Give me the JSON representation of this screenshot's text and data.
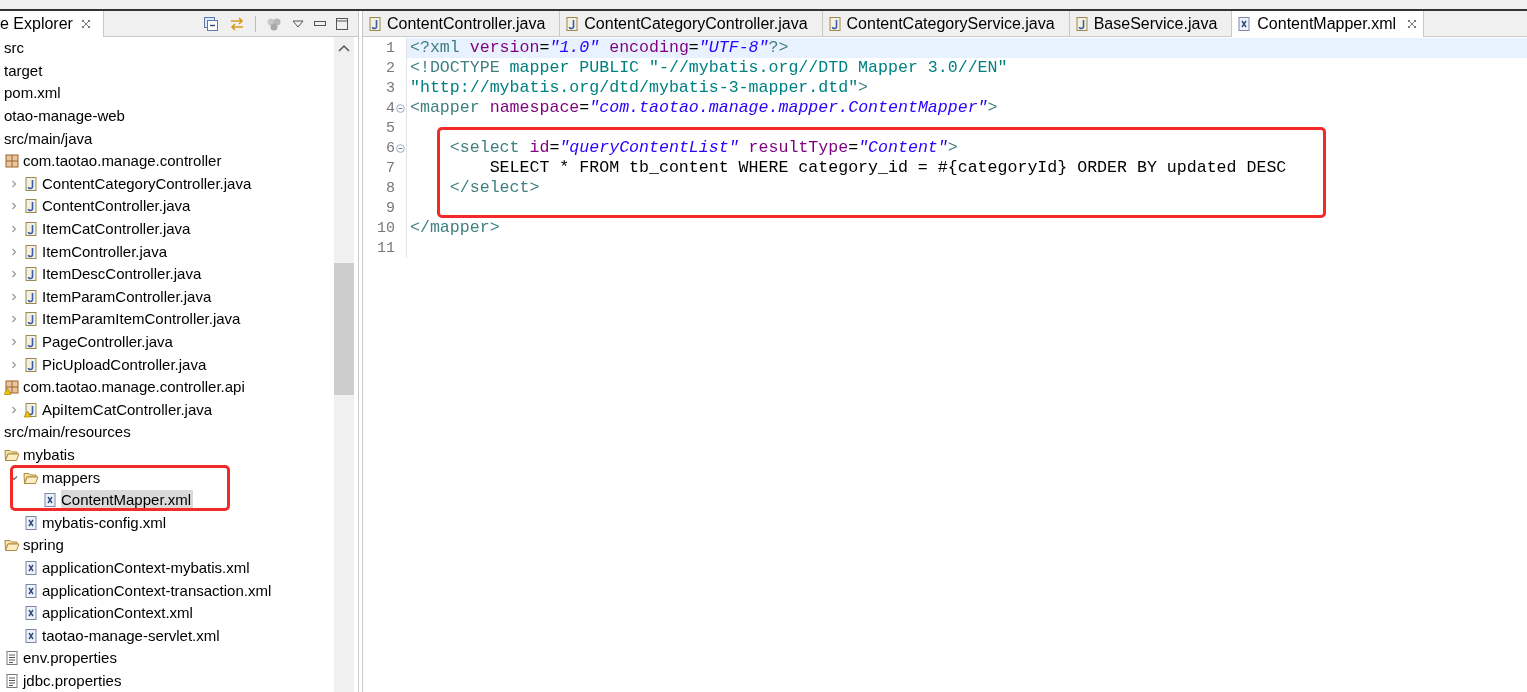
{
  "explorer": {
    "title": "e Explorer",
    "tree": [
      {
        "label": "src",
        "selected": false
      },
      {
        "label": "target",
        "selected": false
      },
      {
        "label": "pom.xml",
        "selected": false
      },
      {
        "label": "otao-manage-web",
        "selected": false
      },
      {
        "label": "src/main/java",
        "selected": false,
        "children": [
          {
            "label": "com.taotao.manage.controller",
            "kind": "package",
            "selected": false,
            "children": [
              {
                "label": "ContentCategoryController.java",
                "kind": "java",
                "expanded": false,
                "selected": false
              },
              {
                "label": "ContentController.java",
                "kind": "java",
                "expanded": false,
                "selected": false
              },
              {
                "label": "ItemCatController.java",
                "kind": "java",
                "expanded": false,
                "selected": false
              },
              {
                "label": "ItemController.java",
                "kind": "java",
                "expanded": false,
                "selected": false
              },
              {
                "label": "ItemDescController.java",
                "kind": "java",
                "expanded": false,
                "selected": false
              },
              {
                "label": "ItemParamController.java",
                "kind": "java",
                "expanded": false,
                "selected": false
              },
              {
                "label": "ItemParamItemController.java",
                "kind": "java",
                "expanded": false,
                "selected": false
              },
              {
                "label": "PageController.java",
                "kind": "java",
                "expanded": false,
                "selected": false
              },
              {
                "label": "PicUploadController.java",
                "kind": "java",
                "expanded": false,
                "selected": false
              }
            ]
          },
          {
            "label": "com.taotao.manage.controller.api",
            "kind": "package-warning",
            "selected": false,
            "children": [
              {
                "label": "ApiItemCatController.java",
                "kind": "java-warning",
                "expanded": false,
                "selected": false
              }
            ]
          }
        ]
      },
      {
        "label": "src/main/resources",
        "selected": false,
        "children": [
          {
            "label": "mybatis",
            "kind": "folder",
            "selected": false,
            "children": [
              {
                "label": "mappers",
                "kind": "folder",
                "expanded": true,
                "selected": false,
                "children": [
                  {
                    "label": "ContentMapper.xml",
                    "kind": "xml",
                    "selected": true
                  }
                ]
              },
              {
                "label": "mybatis-config.xml",
                "kind": "xml",
                "selected": false
              }
            ]
          },
          {
            "label": "spring",
            "kind": "folder",
            "selected": false,
            "children": [
              {
                "label": "applicationContext-mybatis.xml",
                "kind": "xml",
                "selected": false
              },
              {
                "label": "applicationContext-transaction.xml",
                "kind": "xml",
                "selected": false
              },
              {
                "label": "applicationContext.xml",
                "kind": "xml",
                "selected": false
              },
              {
                "label": "taotao-manage-servlet.xml",
                "kind": "xml",
                "selected": false
              }
            ]
          },
          {
            "label": "env.properties",
            "kind": "properties",
            "selected": false
          },
          {
            "label": "jdbc.properties",
            "kind": "properties",
            "selected": false
          }
        ]
      }
    ]
  },
  "editor": {
    "tabs": [
      {
        "label": "ContentController.java",
        "kind": "java",
        "selected": false
      },
      {
        "label": "ContentCategoryController.java",
        "kind": "java",
        "selected": false
      },
      {
        "label": "ContentCategoryService.java",
        "kind": "java",
        "selected": false
      },
      {
        "label": "BaseService.java",
        "kind": "java",
        "selected": false
      },
      {
        "label": "ContentMapper.xml",
        "kind": "xml",
        "selected": true
      }
    ],
    "lines": [
      {
        "number": "1",
        "current": true,
        "fold": false,
        "tokens": [
          {
            "kind": "tag",
            "text": "<?xml "
          },
          {
            "kind": "attr",
            "text": "version"
          },
          {
            "kind": "text",
            "text": "="
          },
          {
            "kind": "value",
            "text": "\"1.0\" "
          },
          {
            "kind": "attr",
            "text": "encoding"
          },
          {
            "kind": "text",
            "text": "="
          },
          {
            "kind": "value",
            "text": "\"UTF-8\""
          },
          {
            "kind": "tag",
            "text": "?>"
          }
        ]
      },
      {
        "number": "2",
        "current": false,
        "fold": false,
        "tokens": [
          {
            "kind": "tag",
            "text": "<!DOCTYPE "
          },
          {
            "kind": "doctype",
            "text": "mapper PUBLIC \"-//mybatis.org//DTD Mapper 3.0//EN\""
          }
        ]
      },
      {
        "number": "3",
        "current": false,
        "fold": false,
        "tokens": [
          {
            "kind": "doctype",
            "text": "\"http://mybatis.org/dtd/mybatis-3-mapper.dtd\""
          },
          {
            "kind": "tag",
            "text": ">"
          }
        ]
      },
      {
        "number": "4",
        "current": false,
        "fold": true,
        "tokens": [
          {
            "kind": "tag",
            "text": "<mapper "
          },
          {
            "kind": "attr",
            "text": "namespace"
          },
          {
            "kind": "text",
            "text": "="
          },
          {
            "kind": "value",
            "text": "\"com.taotao.manage.mapper.ContentMapper\""
          },
          {
            "kind": "tag",
            "text": ">"
          }
        ]
      },
      {
        "number": "5",
        "current": false,
        "fold": false
      },
      {
        "number": "6",
        "current": false,
        "fold": true,
        "tokens": [
          {
            "kind": "tag",
            "text": "    <select "
          },
          {
            "kind": "attr",
            "text": "id"
          },
          {
            "kind": "text",
            "text": "="
          },
          {
            "kind": "value",
            "text": "\"queryContentList\" "
          },
          {
            "kind": "attr",
            "text": "resultType"
          },
          {
            "kind": "text",
            "text": "="
          },
          {
            "kind": "value",
            "text": "\"Content\""
          },
          {
            "kind": "tag",
            "text": ">"
          }
        ]
      },
      {
        "number": "7",
        "current": false,
        "fold": false,
        "tokens": [
          {
            "kind": "text",
            "text": "        SELECT * FROM tb_content WHERE category_id = #{categoryId} ORDER BY updated DESC"
          }
        ]
      },
      {
        "number": "8",
        "current": false,
        "fold": false,
        "tokens": [
          {
            "kind": "tag",
            "text": "    </select>"
          }
        ]
      },
      {
        "number": "9",
        "current": false,
        "fold": false
      },
      {
        "number": "10",
        "current": false,
        "fold": false,
        "tokens": [
          {
            "kind": "tag",
            "text": "</mapper>"
          }
        ]
      },
      {
        "number": "11",
        "current": false,
        "fold": false
      }
    ]
  }
}
